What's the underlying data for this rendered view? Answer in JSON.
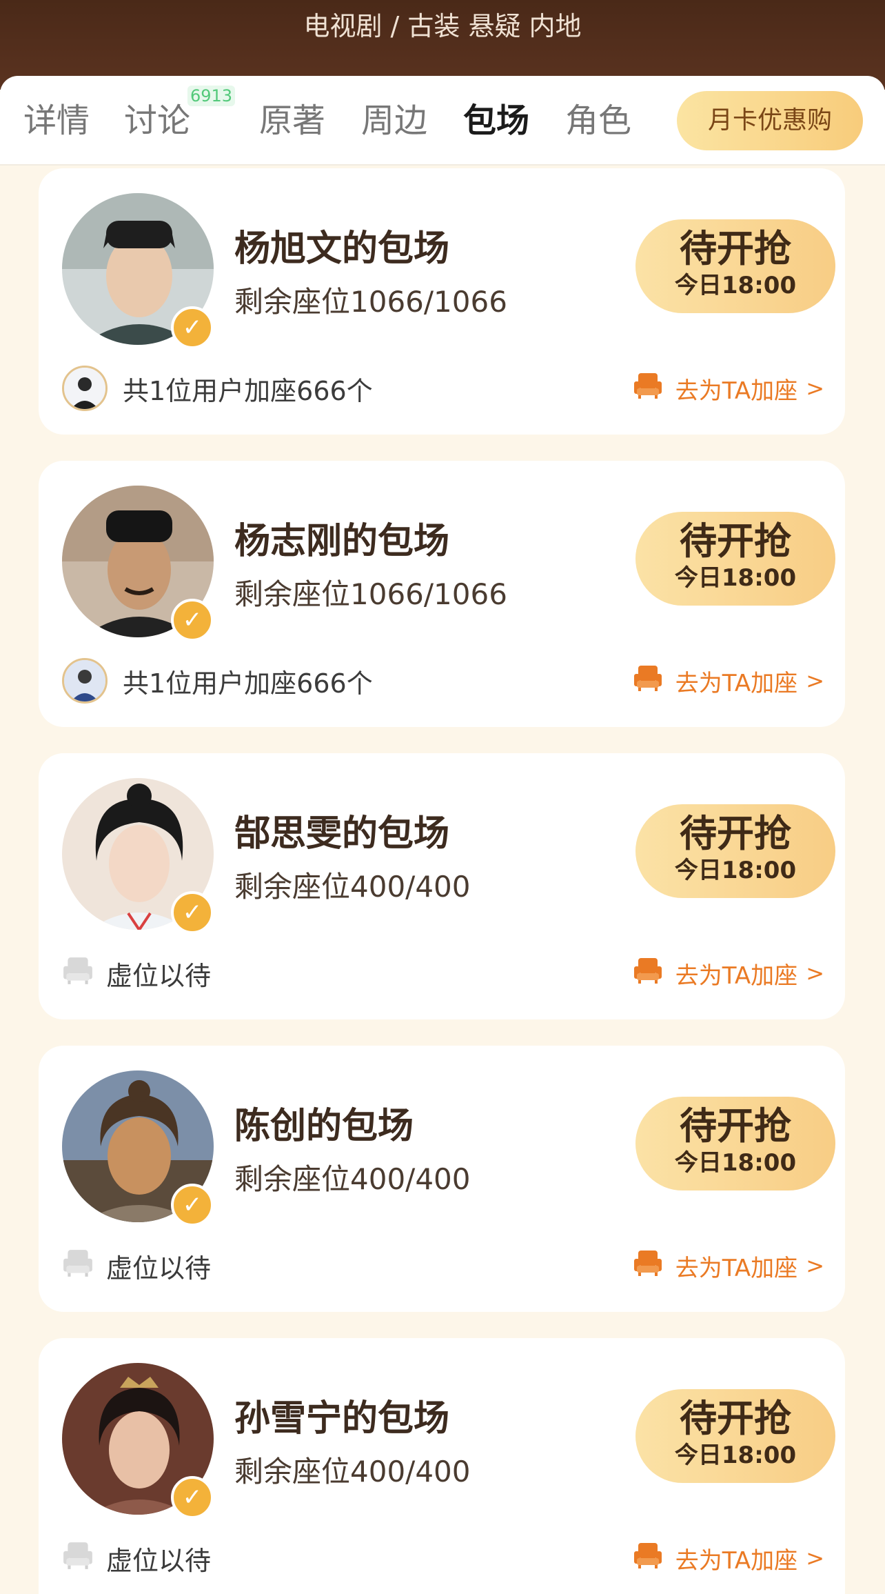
{
  "header": {
    "title": "电视剧 / 古装 悬疑 内地"
  },
  "tabs": [
    {
      "label": "详情"
    },
    {
      "label": "讨论",
      "badge": "6913"
    },
    {
      "label": "原著"
    },
    {
      "label": "周边"
    },
    {
      "label": "包场",
      "active": true
    },
    {
      "label": "角色"
    }
  ],
  "month_card": {
    "label": "月卡优惠购"
  },
  "cards": [
    {
      "name": "杨旭文的包场",
      "seats": "剩余座位1066/1066",
      "button_main": "待开抢",
      "button_time": "今日18:00",
      "footer": "共1位用户加座666个",
      "action": "去为TA加座",
      "action_arrow": ">"
    },
    {
      "name": "杨志刚的包场",
      "seats": "剩余座位1066/1066",
      "button_main": "待开抢",
      "button_time": "今日18:00",
      "footer": "共1位用户加座666个",
      "action": "去为TA加座",
      "action_arrow": ">"
    },
    {
      "name": "郜思雯的包场",
      "seats": "剩余座位400/400",
      "button_main": "待开抢",
      "button_time": "今日18:00",
      "footer": "虚位以待",
      "action": "去为TA加座",
      "action_arrow": ">"
    },
    {
      "name": "陈创的包场",
      "seats": "剩余座位400/400",
      "button_main": "待开抢",
      "button_time": "今日18:00",
      "footer": "虚位以待",
      "action": "去为TA加座",
      "action_arrow": ">"
    },
    {
      "name": "孙雪宁的包场",
      "seats": "剩余座位400/400",
      "button_main": "待开抢",
      "button_time": "今日18:00",
      "footer": "虚位以待",
      "action": "去为TA加座",
      "action_arrow": ">"
    }
  ],
  "colors": {
    "header_bg": "#4a2918",
    "accent_orange": "#ea7a24",
    "button_gold": "#f8cd85",
    "verified_badge": "#f3b23a",
    "page_bg": "#fdf6e9"
  },
  "icons": {
    "verified": "verified-check-icon",
    "seat_filled": "seat-orange-icon",
    "seat_empty": "seat-gray-icon"
  }
}
